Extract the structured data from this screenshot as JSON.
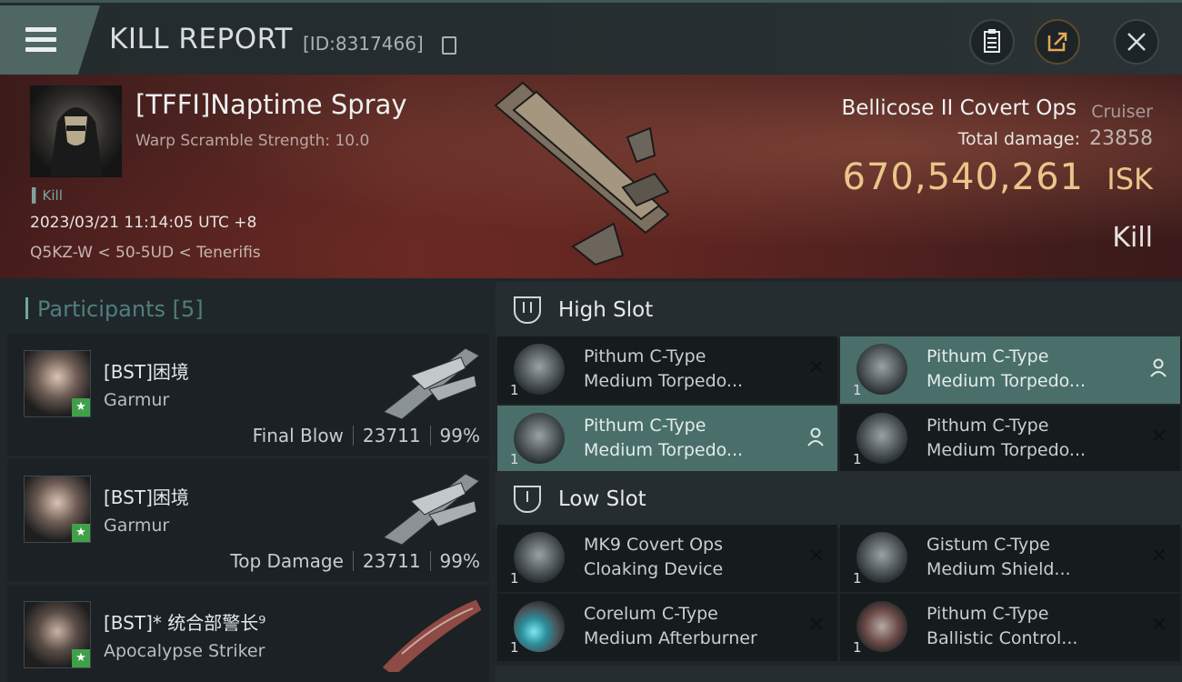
{
  "header": {
    "title": "KILL REPORT",
    "report_id": "[ID:8317466]",
    "icons": {
      "menu": "menu-icon",
      "clipboard": "clipboard-icon",
      "share": "share-icon",
      "close": "close-icon"
    }
  },
  "victim": {
    "name": "[TFFI]Naptime Spray",
    "warp_scramble": "Warp Scramble Strength: 10.0",
    "tag": "Kill",
    "datetime": "2023/03/21 11:14:05 UTC +8",
    "location": "Q5KZ-W < 50-5UD < Tenerifis",
    "ship_name": "Bellicose II Covert Ops",
    "ship_class": "Cruiser",
    "total_damage_label": "Total damage:",
    "total_damage": "23858",
    "isk_value": "670,540,261",
    "isk_unit": "ISK",
    "result": "Kill"
  },
  "participants": {
    "title": "Participants",
    "count": "[5]",
    "rows": [
      {
        "name": "[BST]困境",
        "ship": "Garmur",
        "role": "Final Blow",
        "damage": "23711",
        "percent": "99%"
      },
      {
        "name": "[BST]困境",
        "ship": "Garmur",
        "role": "Top Damage",
        "damage": "23711",
        "percent": "99%"
      },
      {
        "name": "[BST]* 统合部警长⁹",
        "ship": "Apocalypse Striker",
        "role": "",
        "damage": "",
        "percent": ""
      }
    ]
  },
  "fitting": {
    "high_slot": {
      "title": "High Slot",
      "modules": [
        {
          "line1": "Pithum C-Type",
          "line2": "Medium Torpedo...",
          "qty": "1"
        },
        {
          "line1": "Pithum C-Type",
          "line2": "Medium Torpedo...",
          "qty": "1"
        },
        {
          "line1": "Pithum C-Type",
          "line2": "Medium Torpedo...",
          "qty": "1"
        },
        {
          "line1": "Pithum C-Type",
          "line2": "Medium Torpedo...",
          "qty": "1"
        }
      ]
    },
    "low_slot": {
      "title": "Low Slot",
      "modules": [
        {
          "line1": "MK9 Covert Ops",
          "line2": "Cloaking Device",
          "qty": "1"
        },
        {
          "line1": "Gistum C-Type",
          "line2": "Medium Shield...",
          "qty": "1"
        },
        {
          "line1": "Corelum C-Type",
          "line2": "Medium Afterburner",
          "qty": "1"
        },
        {
          "line1": "Pithum C-Type",
          "line2": "Ballistic Control...",
          "qty": "1"
        }
      ]
    }
  },
  "colors": {
    "isk": "#e9c58a",
    "highlight": "#4a6f6a",
    "accent": "#6fa9a2"
  }
}
